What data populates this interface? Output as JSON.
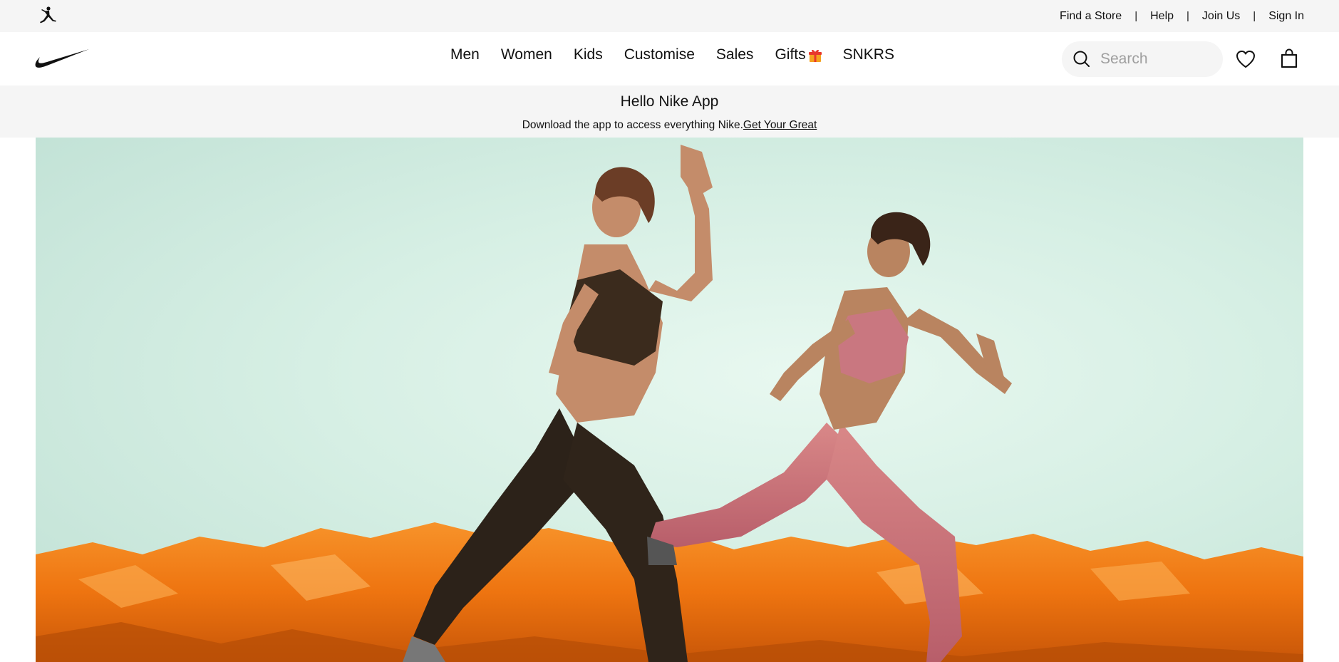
{
  "utility_bar": {
    "brand_icon": "jordan-jumpman-icon",
    "links": [
      "Find a Store",
      "Help",
      "Join Us",
      "Sign In"
    ],
    "separator": "|"
  },
  "main_nav": {
    "logo": "nike-swoosh-icon",
    "menu": [
      "Men",
      "Women",
      "Kids",
      "Customise",
      "Sales",
      "Gifts",
      "SNKRS"
    ],
    "gift_icon": "gift-icon",
    "search": {
      "placeholder": "Search",
      "icon": "search-icon"
    },
    "favourites_icon": "heart-icon",
    "bag_icon": "bag-icon"
  },
  "promo": {
    "title": "Hello Nike App",
    "text": "Download the app to access everything Nike.",
    "link": "Get Your Great"
  },
  "hero": {
    "image": "two-women-lunging-on-orange-foil",
    "colors": {
      "background": "#d6efe4",
      "foil": "#f07a12",
      "outfit_left": "#3a2a1e",
      "outfit_right": "#c9707a"
    }
  }
}
